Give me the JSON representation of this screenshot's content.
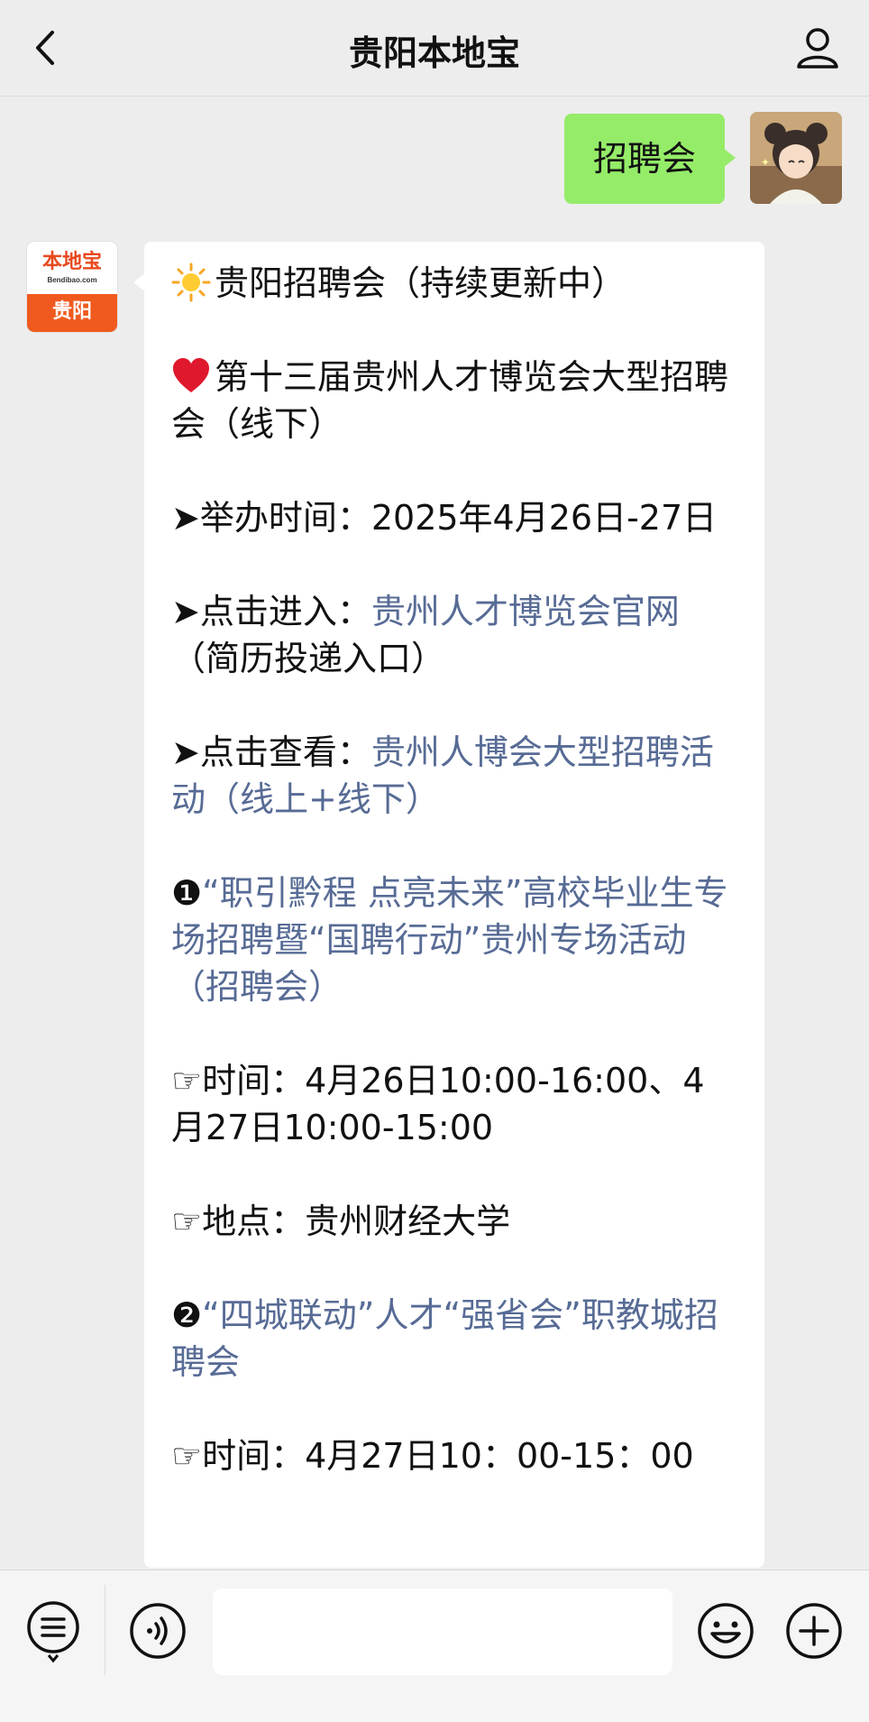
{
  "header": {
    "title": "贵阳本地宝"
  },
  "sent_message": {
    "text": "招聘会"
  },
  "bot_avatar": {
    "brand": "本地宝",
    "domain": "Bendibao.com",
    "city": "贵阳"
  },
  "message": {
    "heading": "贵阳招聘会（持续更新中）",
    "event_title": "第十三届贵州人才博览会大型招聘会（线下）",
    "time_label": "➤举办时间：",
    "time_value": "2025年4月26日-27日",
    "enter_label": "➤点击进入：",
    "enter_link": "贵州人才博览会官网",
    "enter_note": "（简历投递入口）",
    "view_label": "➤点击查看：",
    "view_link": "贵州人博会大型招聘活动（线上+线下）",
    "item1_num": "❶",
    "item1_link": "“职引黔程 点亮未来”高校毕业生专场招聘暨“国聘行动”贵州专场活动（招聘会）",
    "item1_time": "☞时间：4月26日10:00-16:00、4月27日10:00-15:00",
    "item1_place": "☞地点：贵州财经大学",
    "item2_num": "❷",
    "item2_link": "“四城联动”人才“强省会”职教城招聘会",
    "item2_time": "☞时间：4月27日10：00-15：00"
  },
  "input": {
    "value": ""
  },
  "colors": {
    "sent_bubble": "#95ec69",
    "link": "#576b95",
    "background": "#ededed"
  },
  "icons": [
    "back-arrow-icon",
    "person-icon",
    "sun-icon",
    "heart-icon",
    "menu-list-icon",
    "voice-icon",
    "emoji-icon",
    "plus-icon"
  ]
}
